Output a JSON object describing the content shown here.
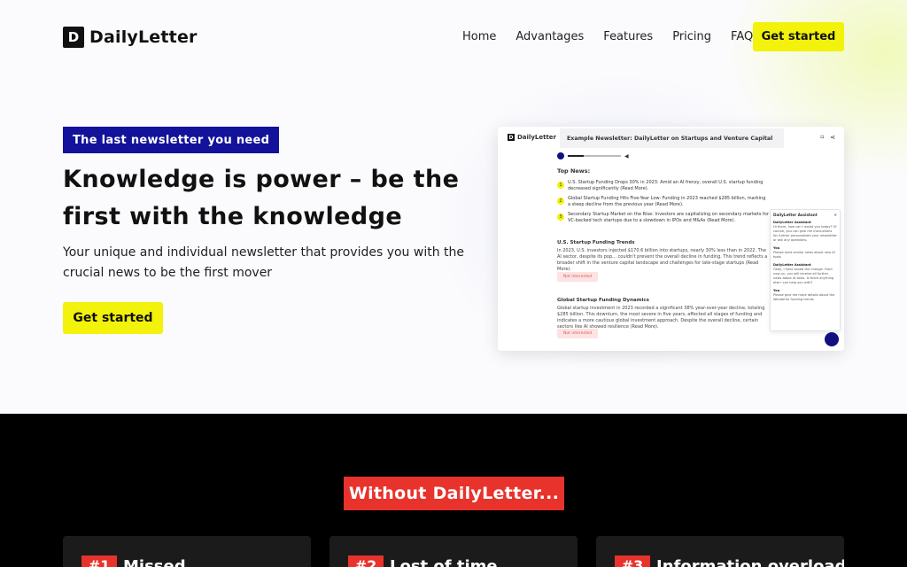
{
  "brand": {
    "logo_letter": "D",
    "name": "DailyLetter"
  },
  "nav": {
    "items": [
      "Home",
      "Advantages",
      "Features",
      "Pricing",
      "FAQ"
    ],
    "cta": "Get started"
  },
  "hero": {
    "tag": "The last newsletter you need",
    "headline": "Knowledge is power – be the first with the knowledge",
    "subheadline": "Your unique and individual newsletter that provides you with the crucial news to be the first mover",
    "cta": "Get started"
  },
  "preview": {
    "logo_letter": "D",
    "logo_name": "DailyLetter",
    "title": "Example Newsletter: DailyLetter on Startups and Venture Capital",
    "top_news_label": "Top News:",
    "top_news": [
      {
        "n": "1",
        "text": "U.S. Startup Funding Drops 30% in 2023: Amid an AI frenzy, overall U.S. startup funding decreased significantly (Read More)."
      },
      {
        "n": "2",
        "text": "Global Startup Funding Hits Five-Year Low: Funding in 2023 reached $285 billion, marking a steep decline from the previous year (Read More)."
      },
      {
        "n": "3",
        "text": "Secondary Startup Market on the Rise: Investors are capitalizing on secondary markets for VC-backed tech startups due to a slowdown in IPOs and M&As (Read More)."
      }
    ],
    "sections": [
      {
        "title": "U.S. Startup Funding Trends",
        "text": "In 2023, U.S. investors injected $170.6 billion into startups, nearly 30% less than in 2022. The AI sector, despite its pop... couldn't prevent the overall decline in funding. This trend reflects a broader shift in the venture capital landscape and challenges for late-stage startups (Read More).",
        "badge": "Not interested"
      },
      {
        "title": "Global Startup Funding Dynamics",
        "text": "Global startup investment in 2023 recorded a significant 38% year-over-year decline, totaling $285 billion. This downturn, the most severe in five years, affected all stages of funding and indicates a more cautious global investment approach. Despite the overall decline, certain sectors like AI showed resilience (Read More).",
        "badge": "Not interested"
      }
    ],
    "chat": {
      "title": "DailyLetter Assistant",
      "messages": [
        {
          "who": "DailyLetter Assistant",
          "text": "Hi there, how can I assist you today? Of course, you can give me instructions for further personalized your newsletter or ask any questions."
        },
        {
          "who": "You",
          "text": "Please send similar news about new AI tools"
        },
        {
          "who": "DailyLetter Assistant",
          "text": "Okay, I have saved the change. From now on, you will receive all further news about AI tools. Is there anything else I can help you with?"
        },
        {
          "who": "You",
          "text": "Please give me more details about the Wonderful funding trends"
        }
      ]
    }
  },
  "problems": {
    "heading": "Without DailyLetter...",
    "cards": [
      {
        "num": "#1",
        "title": "Missed ..."
      },
      {
        "num": "#2",
        "title": "Lost of time..."
      },
      {
        "num": "#3",
        "title": "Information overload"
      }
    ]
  },
  "colors": {
    "accent_yellow": "#f2f20a",
    "tag_blue": "#12129a",
    "alert_red": "#e8322c",
    "dark_bg": "#000000"
  }
}
